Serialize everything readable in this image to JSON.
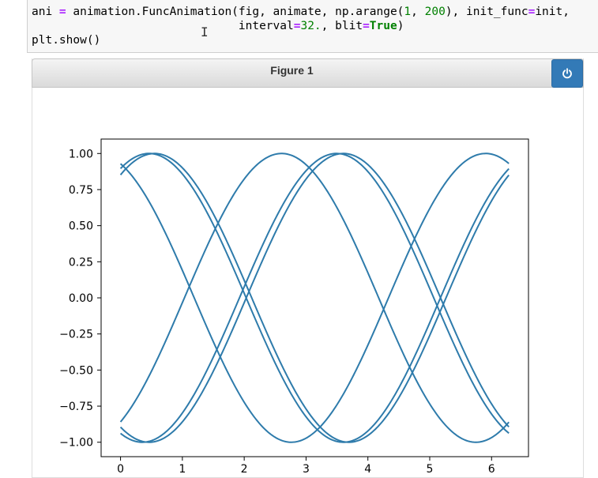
{
  "code": {
    "line1_parts": [
      "ani ",
      "=",
      " animation.FuncAnimation(fig, animate, np.arange(",
      "1",
      ", ",
      "200",
      "), init_func",
      "=",
      "init,"
    ],
    "line2_parts": [
      "                              interval",
      "=",
      "32.",
      ", blit",
      "=",
      "True",
      ")"
    ],
    "line3": "plt.show()"
  },
  "figure": {
    "title": "Figure 1",
    "power_icon": "power-icon",
    "accent_color": "#337ab7"
  },
  "chart_data": {
    "type": "line",
    "title": "",
    "xlabel": "",
    "ylabel": "",
    "xlim": [
      -0.314,
      6.597
    ],
    "ylim": [
      -1.1,
      1.1
    ],
    "x_ticks": [
      0,
      1,
      2,
      3,
      4,
      5,
      6
    ],
    "x_tick_labels": [
      "0",
      "1",
      "2",
      "3",
      "4",
      "5",
      "6"
    ],
    "y_ticks": [
      1.0,
      0.75,
      0.5,
      0.25,
      0.0,
      -0.25,
      -0.5,
      -0.75,
      -1.0
    ],
    "y_tick_labels": [
      "1.00",
      "0.75",
      "0.50",
      "0.25",
      "0.00",
      "−0.25",
      "−0.50",
      "−0.75",
      "−1.00"
    ],
    "grid": false,
    "line_color": "#2e7bab",
    "x_range": [
      0,
      6.28
    ],
    "series": [
      {
        "function": "sin",
        "phase": 1.02
      },
      {
        "function": "sin",
        "phase": 1.11
      },
      {
        "function": "sin",
        "phase": 1.95
      },
      {
        "function": "sin",
        "phase": 4.25
      },
      {
        "function": "sin",
        "phase": 4.36
      },
      {
        "function": "sin",
        "phase": 5.25
      }
    ]
  }
}
